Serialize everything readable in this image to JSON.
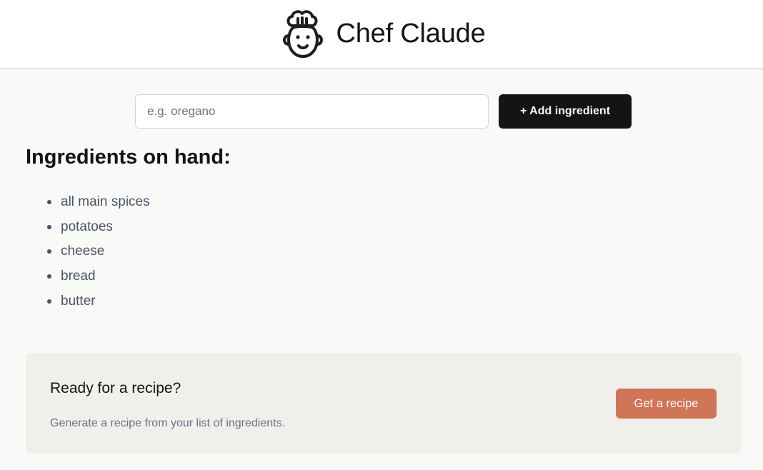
{
  "header": {
    "title": "Chef Claude",
    "logo_icon": "chef-hat-icon"
  },
  "form": {
    "input_value": "",
    "input_placeholder": "e.g. oregano",
    "add_label": "+ Add ingredient"
  },
  "ingredients": {
    "heading": "Ingredients on hand:",
    "items": [
      "all main spices",
      "potatoes",
      "cheese",
      "bread",
      "butter"
    ]
  },
  "recipe_cta": {
    "title": "Ready for a recipe?",
    "subtitle": "Generate a recipe from your list of ingredients.",
    "button_label": "Get a recipe"
  },
  "colors": {
    "background": "#f9f9f7",
    "header_bg": "#ffffff",
    "primary_button": "#141413",
    "accent_button": "#d17557",
    "card_bg": "#f0efec",
    "list_text": "#475467"
  }
}
